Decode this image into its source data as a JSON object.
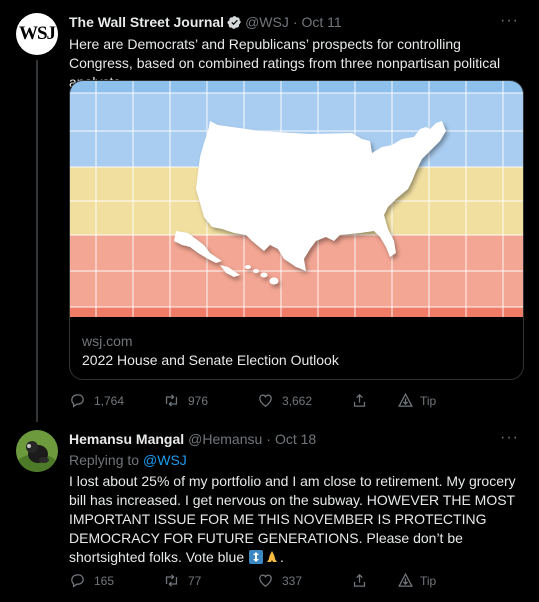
{
  "tweets": [
    {
      "author_name": "The Wall Street Journal",
      "avatar_label": "WSJ",
      "handle": "@WSJ",
      "separator": "·",
      "date": "Oct 11",
      "more": "···",
      "text": "Here are Democrats’ and Republicans’ prospects for controlling Congress, based on combined ratings from three nonpartisan political analysts.",
      "card": {
        "domain": "wsj.com",
        "title": "2022 House and Senate Election Outlook"
      },
      "actions": {
        "replies": "1,764",
        "retweets": "976",
        "likes": "3,662",
        "tip": "Tip"
      }
    },
    {
      "author_name": "Hemansu Mangal",
      "handle": "@Hemansu",
      "separator": "·",
      "date": "Oct 18",
      "more": "···",
      "replying_label": "Replying to",
      "replying_handle": "@WSJ",
      "text": "I lost about 25% of my portfolio and I am close to retirement.  My grocery bill has increased. I get nervous on the subway.  HOWEVER THE MOST IMPORTANT ISSUE FOR ME THIS NOVEMBER IS PROTECTING DEMOCRACY FOR FUTURE GENERATIONS.  Please don’t be shortsighted folks. Vote blue",
      "text_suffix": ".",
      "actions": {
        "replies": "165",
        "retweets": "77",
        "likes": "337",
        "tip": "Tip"
      }
    }
  ],
  "colors": {
    "band_blue": "#a9cdf0",
    "band_yellow": "#f1dfa0",
    "band_red": "#f3a693",
    "link": "#1d9bf0"
  }
}
